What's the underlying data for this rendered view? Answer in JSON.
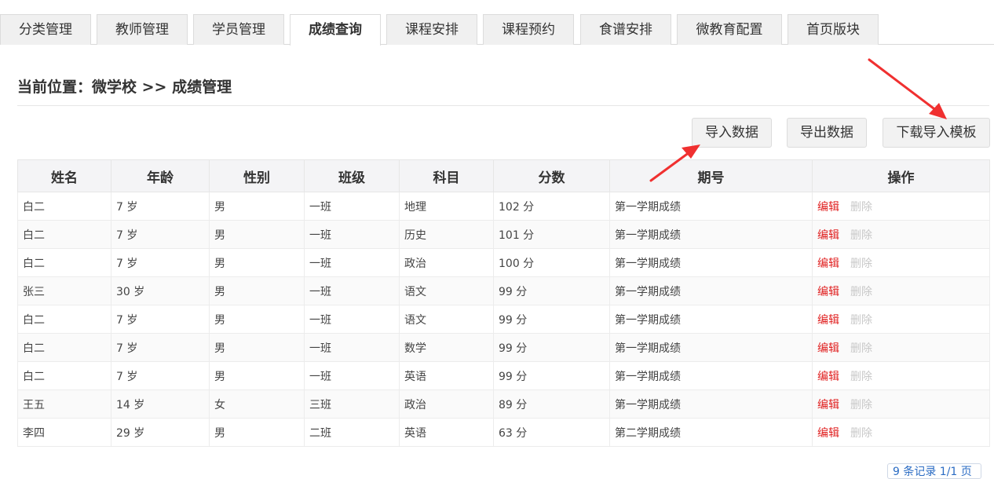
{
  "tabs": [
    {
      "label": "分类管理",
      "active": false
    },
    {
      "label": "教师管理",
      "active": false
    },
    {
      "label": "学员管理",
      "active": false
    },
    {
      "label": "成绩查询",
      "active": true
    },
    {
      "label": "课程安排",
      "active": false
    },
    {
      "label": "课程预约",
      "active": false
    },
    {
      "label": "食谱安排",
      "active": false
    },
    {
      "label": "微教育配置",
      "active": false
    },
    {
      "label": "首页版块",
      "active": false
    }
  ],
  "breadcrumb": "当前位置：微学校 >> 成绩管理",
  "toolbar": {
    "import_label": "导入数据",
    "export_label": "导出数据",
    "template_label": "下载导入模板"
  },
  "table": {
    "headers": [
      "姓名",
      "年龄",
      "性别",
      "班级",
      "科目",
      "分数",
      "期号",
      "操作"
    ],
    "rows": [
      [
        "白二",
        "7 岁",
        "男",
        "一班",
        "地理",
        "102 分",
        "第一学期成绩"
      ],
      [
        "白二",
        "7 岁",
        "男",
        "一班",
        "历史",
        "101 分",
        "第一学期成绩"
      ],
      [
        "白二",
        "7 岁",
        "男",
        "一班",
        "政治",
        "100 分",
        "第一学期成绩"
      ],
      [
        "张三",
        "30 岁",
        "男",
        "一班",
        "语文",
        "99 分",
        "第一学期成绩"
      ],
      [
        "白二",
        "7 岁",
        "男",
        "一班",
        "语文",
        "99 分",
        "第一学期成绩"
      ],
      [
        "白二",
        "7 岁",
        "男",
        "一班",
        "数学",
        "99 分",
        "第一学期成绩"
      ],
      [
        "白二",
        "7 岁",
        "男",
        "一班",
        "英语",
        "99 分",
        "第一学期成绩"
      ],
      [
        "王五",
        "14 岁",
        "女",
        "三班",
        "政治",
        "89 分",
        "第一学期成绩"
      ],
      [
        "李四",
        "29 岁",
        "男",
        "二班",
        "英语",
        "63 分",
        "第二学期成绩"
      ]
    ],
    "edit_label": "编辑",
    "delete_label": "删除"
  },
  "pager_text": "9 条记录 1/1 页",
  "colors": {
    "accent_edit": "#e02020",
    "disabled": "#c8c8c8",
    "annotation_arrow": "#f03030"
  }
}
